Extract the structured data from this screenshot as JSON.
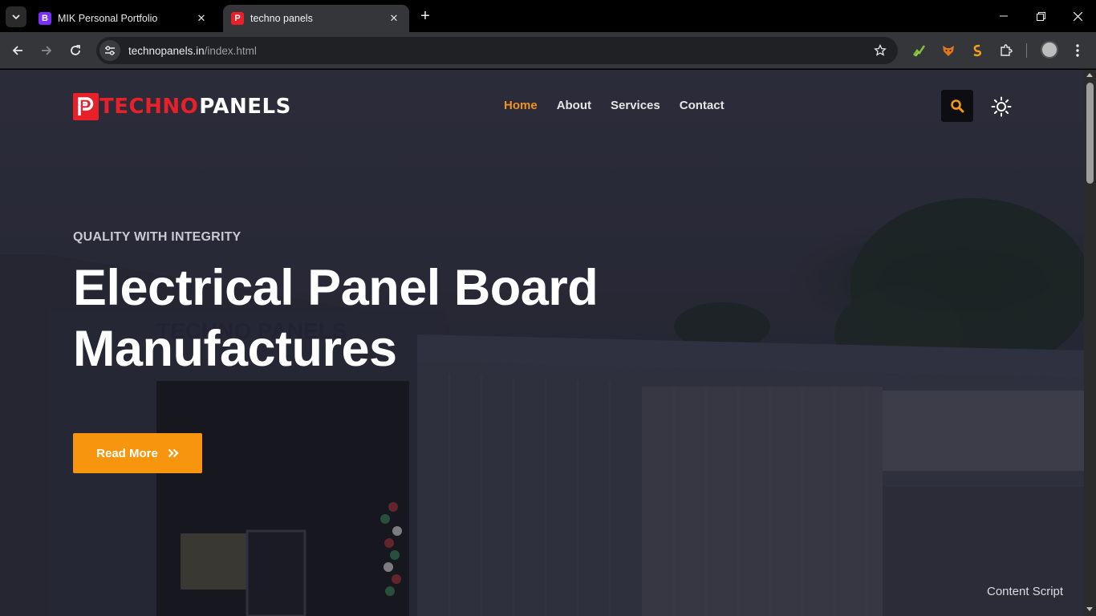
{
  "browser": {
    "tabs": [
      {
        "title": "MIK Personal Portfolio",
        "favicon_letter": "B",
        "favicon_color": "#7b2ff7",
        "active": false
      },
      {
        "title": "techno panels",
        "favicon_letter": "P",
        "favicon_color": "#e8202a",
        "active": true
      }
    ],
    "new_tab_label": "+",
    "url_host": "technopanels.in",
    "url_path": "/index.html",
    "extensions": [
      "chart-extension-icon",
      "fox-extension-icon",
      "s-extension-icon",
      "puzzle-icon"
    ]
  },
  "site": {
    "logo": {
      "part_red": "TECHNO",
      "part_white": "PANELS",
      "brand_red": "#e8202a"
    },
    "nav": [
      {
        "label": "Home",
        "active": true
      },
      {
        "label": "About",
        "active": false
      },
      {
        "label": "Services",
        "active": false
      },
      {
        "label": "Contact",
        "active": false
      }
    ],
    "accent_color": "#f7960e"
  },
  "hero": {
    "subtitle": "QUALITY WITH INTEGRITY",
    "title_line1": "Electrical Panel Board",
    "title_line2": "Manufactures",
    "button_label": "Read More"
  },
  "overlay": {
    "content_script": "Content Script"
  },
  "scene_sign": "TECHNO PANELS"
}
